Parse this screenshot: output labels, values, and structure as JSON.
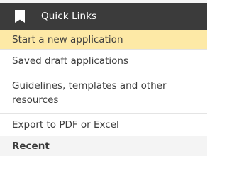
{
  "header": {
    "icon": "bookmark-icon",
    "title": "Quick Links",
    "background": "#3b3b3b"
  },
  "menu": {
    "items": [
      {
        "label": "Start a new application",
        "active": true
      },
      {
        "label": "Saved draft applications",
        "active": false
      },
      {
        "label": "Guidelines, templates and other resources",
        "active": false
      },
      {
        "label": "Export to PDF or Excel",
        "active": false
      }
    ],
    "active_color": "#fde9a6"
  },
  "recent": {
    "label": "Recent"
  }
}
